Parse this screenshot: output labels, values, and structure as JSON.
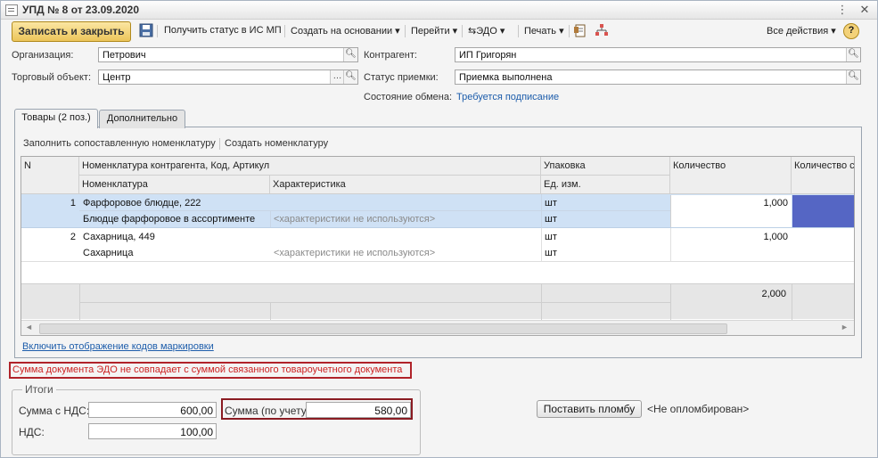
{
  "window": {
    "title": "УПД № 8 от 23.09.2020"
  },
  "toolbar": {
    "save_close": "Записать и закрыть",
    "get_status": "Получить статус в ИС МП",
    "create_based": "Создать на основании",
    "goto": "Перейти",
    "edo": "ЭДО",
    "print": "Печать",
    "all_actions": "Все действия",
    "help": "?"
  },
  "form": {
    "org_label": "Организация:",
    "org_value": "Петрович",
    "trade_label": "Торговый объект:",
    "trade_value": "Центр",
    "contractor_label": "Контрагент:",
    "contractor_value": "ИП Григорян",
    "accept_label": "Статус приемки:",
    "accept_value": "Приемка выполнена",
    "exchange_label": "Состояние обмена:",
    "exchange_value": "Требуется подписание"
  },
  "tabs": [
    {
      "label": "Товары (2 поз.)"
    },
    {
      "label": "Дополнительно"
    }
  ],
  "table_commands": {
    "fill": "Заполнить сопоставленную номенклатуру",
    "create": "Создать номенклатуру"
  },
  "table": {
    "headers": {
      "n": "N",
      "contractor_item": "Номенклатура контрагента, Код, Артикул",
      "item": "Номенклатура",
      "characteristic": "Характеристика",
      "package": "Упаковка",
      "unit": "Ед. изм.",
      "qty": "Количество",
      "qty2": "Количество с"
    },
    "rows": [
      {
        "n": "1",
        "contractor_item": "Фарфоровое блюдце, 222",
        "item": "Блюдце фарфоровое в ассортименте",
        "characteristic": "<характеристики не используются>",
        "package": "шт",
        "unit": "шт",
        "qty": "1,000"
      },
      {
        "n": "2",
        "contractor_item": "Сахарница, 449",
        "item": "Сахарница",
        "characteristic": "<характеристики не используются>",
        "package": "шт",
        "unit": "шт",
        "qty": "1,000"
      }
    ],
    "total_qty": "2,000"
  },
  "marking_link": "Включить отображение кодов маркировки",
  "error_message": "Сумма документа ЭДО не совпадает с суммой связанного товароучетного документа",
  "totals": {
    "title": "Итоги",
    "sum_vat_label": "Сумма с НДС:",
    "sum_vat_value": "600,00",
    "vat_label": "НДС:",
    "vat_value": "100,00",
    "sum_acc_label": "Сумма (по учету):",
    "sum_acc_value": "580,00"
  },
  "seal": {
    "button": "Поставить пломбу",
    "status": "<Не опломбирован>"
  },
  "colors": {
    "selected_row": "#cfe1f5",
    "selected_cell": "#5566c4",
    "error": "#c22222",
    "primary_button": "#ecc55a"
  }
}
